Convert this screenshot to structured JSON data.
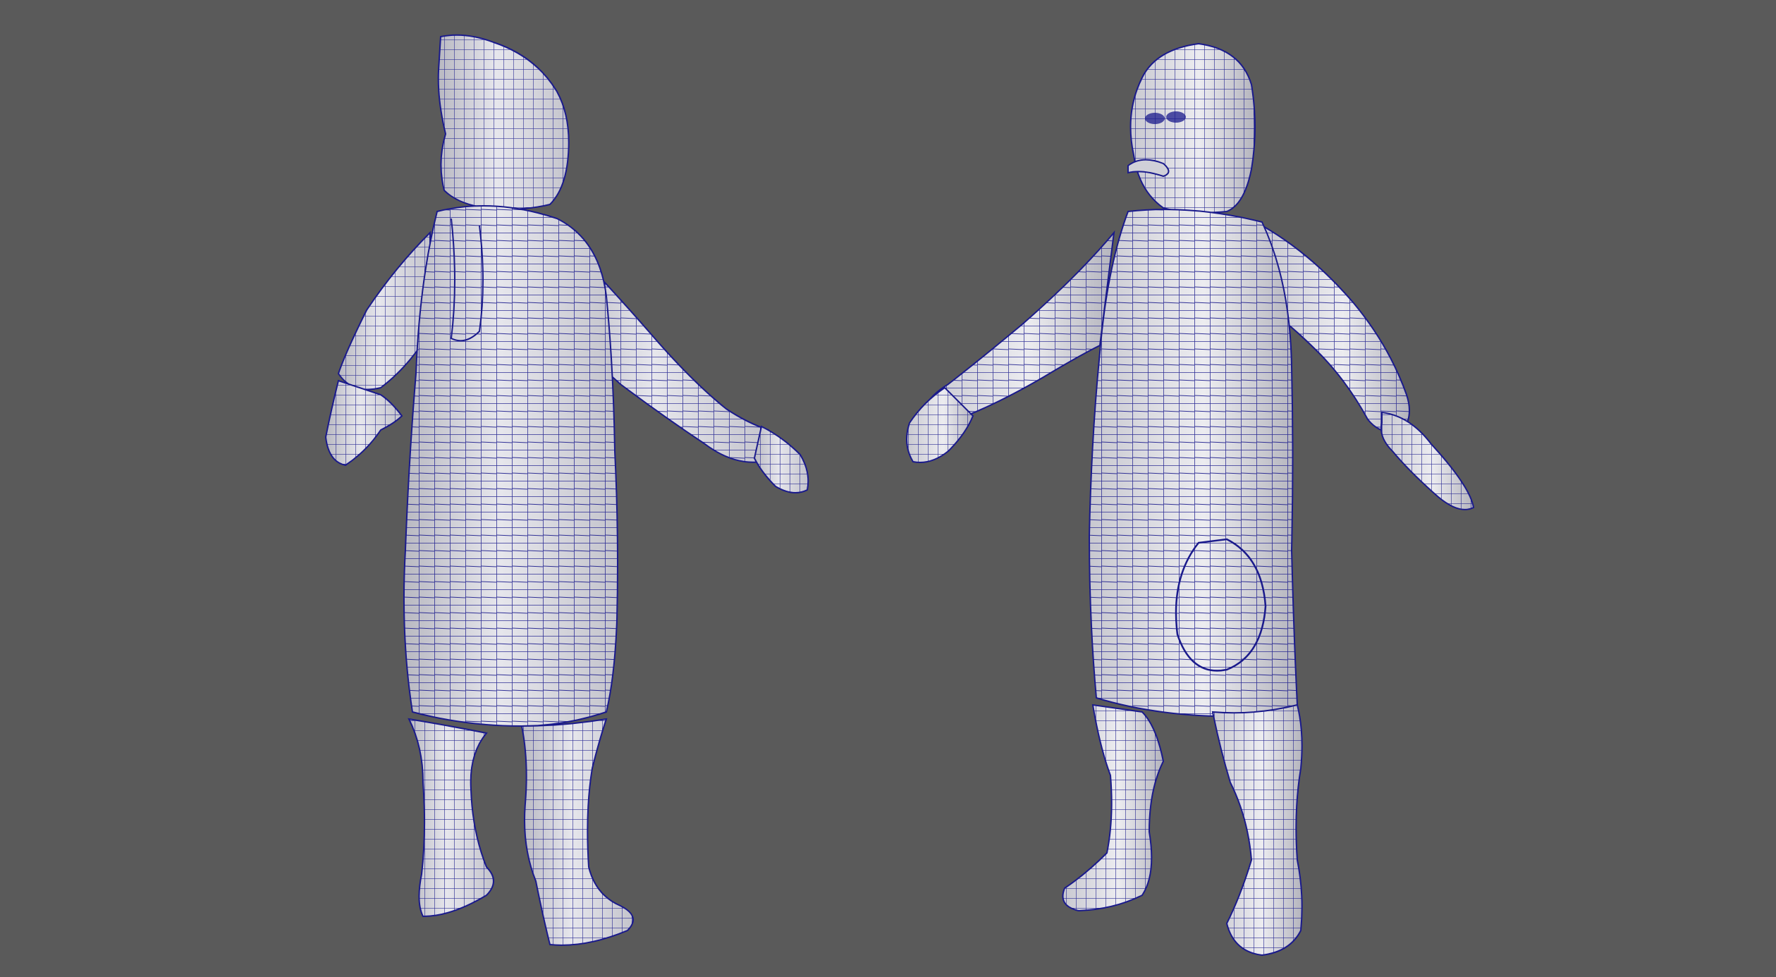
{
  "viewport": {
    "background_color": "#5a5a5a"
  },
  "models": [
    {
      "id": "back-view",
      "description_name": "character-mesh-back-view",
      "display_mode": "wireframe-on-shaded",
      "shaded_color": "#dcdce2",
      "wire_color": "#1a1a8c"
    },
    {
      "id": "front-view",
      "description_name": "character-mesh-front-view",
      "display_mode": "wireframe-on-shaded",
      "shaded_color": "#dcdce2",
      "wire_color": "#1a1a8c"
    }
  ]
}
